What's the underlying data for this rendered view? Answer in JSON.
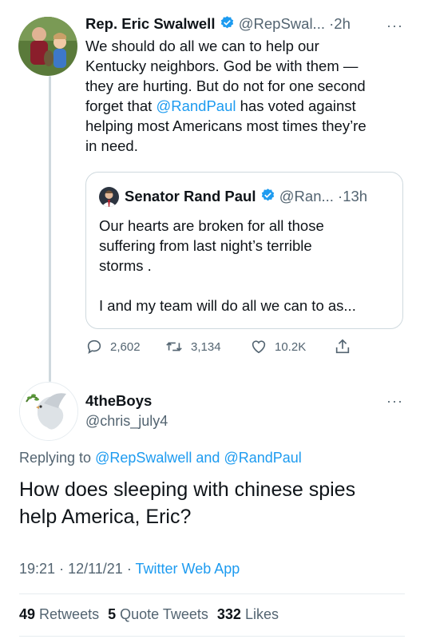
{
  "main_tweet": {
    "display_name": "Rep. Eric Swalwell",
    "handle": "@RepSwal...",
    "separator": "·",
    "time": "2h",
    "lines": [
      "We should do all we can to help our",
      "Kentucky neighbors. God be with them —",
      "they are hurting. But do not for one second",
      "forget that ",
      "@RandPaul",
      " has voted against",
      "helping most Americans most times they’re",
      "in need."
    ]
  },
  "quote_tweet": {
    "display_name": "Senator Rand Paul",
    "handle": "@Ran...",
    "separator": "·",
    "time": "13h",
    "lines": [
      "Our hearts are broken for all those",
      "suffering from last night’s terrible",
      "storms .",
      "I and my team will do all we can to as..."
    ]
  },
  "actions": {
    "replies": "2,602",
    "retweets": "3,134",
    "likes": "10.2K"
  },
  "reply_tweet": {
    "display_name": "4theBoys",
    "handle": "@chris_july4",
    "replying_to_prefix": "Replying to ",
    "replying_to_user1": "@RepSwalwell",
    "replying_to_and": " and ",
    "replying_to_user2": "@RandPaul",
    "line1": "How does sleeping with chinese spies",
    "line2": "help America, Eric?",
    "time": "19:21",
    "date": "12/11/21",
    "separator": "·",
    "source": "Twitter Web App"
  },
  "stats": {
    "retweets_count": "49",
    "retweets_label": "Retweets",
    "quotes_count": "5",
    "quotes_label": "Quote Tweets",
    "likes_count": "332",
    "likes_label": "Likes"
  },
  "colors": {
    "accent": "#1d9bf0",
    "text": "#0f1419",
    "muted": "#536471",
    "border": "#cfd9de"
  }
}
